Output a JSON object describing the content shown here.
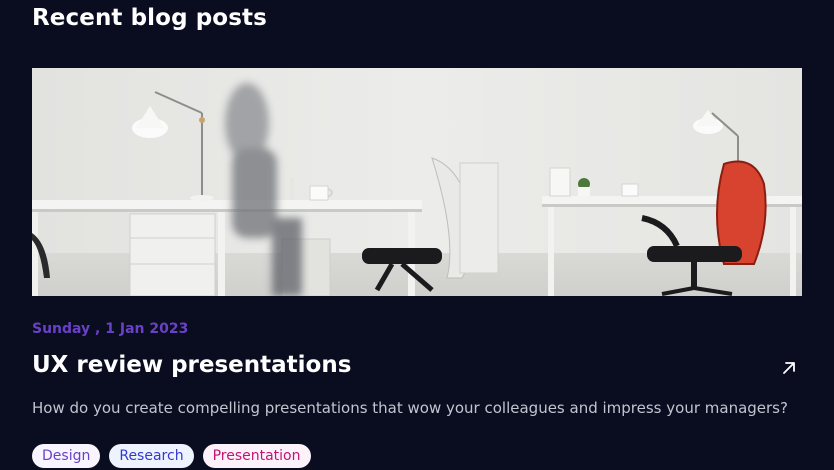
{
  "section": {
    "title": "Recent blog posts"
  },
  "post": {
    "image_alt": "Office desks with chairs",
    "date": "Sunday , 1 Jan 2023",
    "title": "UX review presentations",
    "excerpt": "How do you create compelling presentations that wow your colleagues and impress your managers?",
    "arrow_icon": "arrow-up-right-icon",
    "tags": [
      {
        "label": "Design",
        "color": "#6941c6",
        "bg": "#f9f5ff"
      },
      {
        "label": "Research",
        "color": "#3538cd",
        "bg": "#eef4ff"
      },
      {
        "label": "Presentation",
        "color": "#c11574",
        "bg": "#fdf2fa"
      }
    ]
  },
  "colors": {
    "background": "#090d1f",
    "accent": "#6941c6",
    "heading": "#ffffff",
    "body_text": "#c0c5d0"
  }
}
